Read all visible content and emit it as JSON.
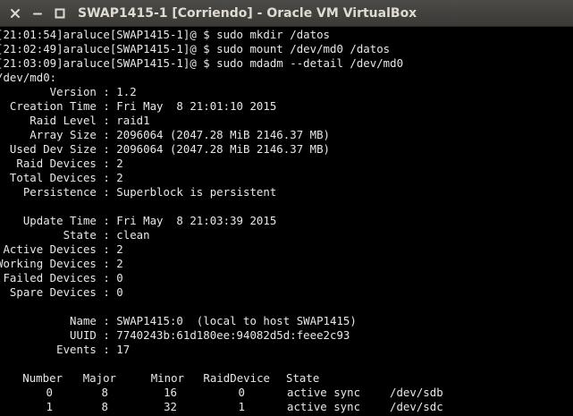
{
  "window": {
    "title": "SWAP1415-1 [Corriendo] - Oracle VM VirtualBox",
    "buttons": [
      "close-icon",
      "minimize-icon",
      "maximize-icon"
    ]
  },
  "terminal": {
    "commands": [
      "[21:01:54]araluce[SWAP1415-1]@ $ sudo mkdir /datos",
      "[21:02:49]araluce[SWAP1415-1]@ $ sudo mount /dev/md0 /datos",
      "[21:03:09]araluce[SWAP1415-1]@ $ sudo mdadm --detail /dev/md0"
    ],
    "device": "/dev/md0:",
    "details1": [
      "        Version : 1.2",
      "  Creation Time : Fri May  8 21:01:10 2015",
      "     Raid Level : raid1",
      "     Array Size : 2096064 (2047.28 MiB 2146.37 MB)",
      "  Used Dev Size : 2096064 (2047.28 MiB 2146.37 MB)",
      "   Raid Devices : 2",
      "  Total Devices : 2",
      "    Persistence : Superblock is persistent"
    ],
    "details2": [
      "    Update Time : Fri May  8 21:03:39 2015",
      "          State : clean",
      " Active Devices : 2",
      "Working Devices : 2",
      " Failed Devices : 0",
      "  Spare Devices : 0"
    ],
    "details3": [
      "           Name : SWAP1415:0  (local to host SWAP1415)",
      "           UUID : 7740243b:61d180ee:94082d5d:feee2c93",
      "         Events : 17"
    ],
    "table": {
      "headers": [
        "Number",
        "Major",
        "Minor",
        "RaidDevice",
        "State"
      ],
      "rows": [
        {
          "number": "0",
          "major": "8",
          "minor": "16",
          "raid": "0",
          "state": "active sync",
          "dev": "/dev/sdb"
        },
        {
          "number": "1",
          "major": "8",
          "minor": "32",
          "raid": "1",
          "state": "active sync",
          "dev": "/dev/sdc"
        }
      ]
    }
  },
  "colors": {
    "titlebar": "#3f3e3a",
    "title_text": "#dfdbd2",
    "terminal_bg": "#000000",
    "terminal_text": "#e8e8e8"
  }
}
